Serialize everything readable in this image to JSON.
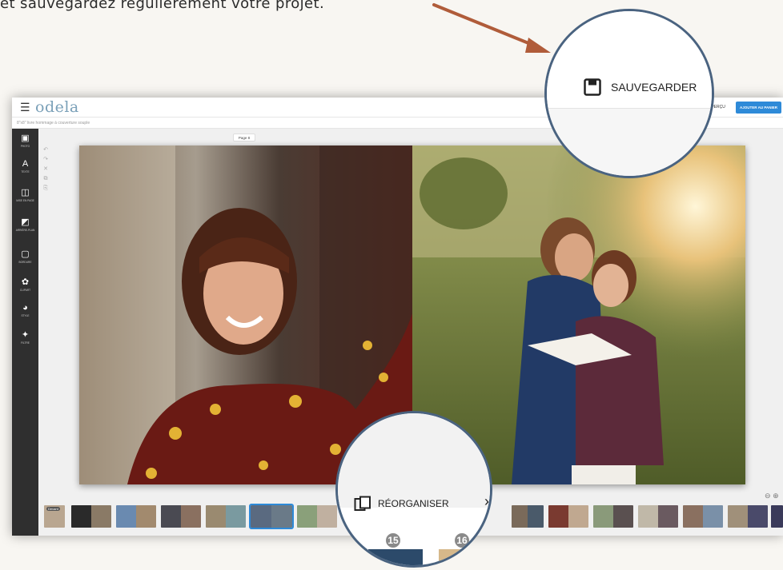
{
  "instruction": {
    "text": "et sauvegardez régulièrement votre projet."
  },
  "app": {
    "logo": "odela",
    "project_title": "8\"x8\" livre hommage à couverture souple",
    "preview_label": "APERÇU",
    "cart_button": "AJOUTER AU PANIER",
    "page_label": "Page 8",
    "menu_icon": "hamburger-icon"
  },
  "sidebar": {
    "items": [
      {
        "label": "PHOTO",
        "icon": "image-icon"
      },
      {
        "label": "TEXTE",
        "icon": "text-icon"
      },
      {
        "label": "MISE EN PAGE",
        "icon": "layout-icon"
      },
      {
        "label": "ARRIÈRE-PLAN",
        "icon": "background-icon"
      },
      {
        "label": "BORDURE",
        "icon": "border-icon"
      },
      {
        "label": "CLIPART",
        "icon": "clipart-icon"
      },
      {
        "label": "STYLE",
        "icon": "palette-icon"
      },
      {
        "label": "FILTRE",
        "icon": "sparkle-icon"
      }
    ]
  },
  "zoom_callouts": {
    "save_label": "SAUVEGARDER",
    "reorganize_label": "RÉORGANISER",
    "page_badges": [
      "15",
      "16"
    ]
  },
  "thumbnails": {
    "first_label": "Devant",
    "count_badge_color": "#555555"
  },
  "colors": {
    "accent": "#2e8ad8",
    "arrow": "#b05c3a",
    "circle_border": "#4a6380",
    "sidebar_bg": "#2f2f2f"
  }
}
